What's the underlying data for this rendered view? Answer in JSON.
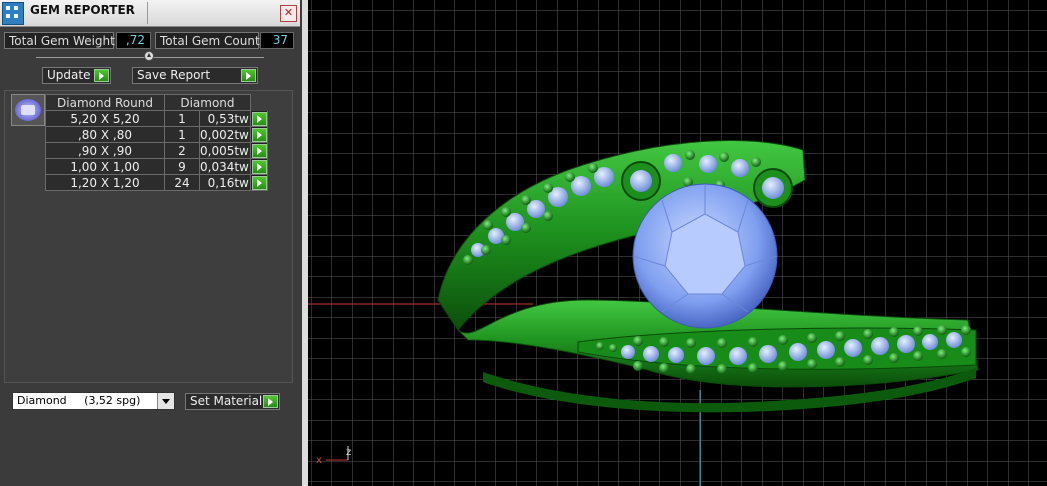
{
  "window": {
    "title": "GEM REPORTER",
    "close_label": "✕"
  },
  "summary": {
    "total_weight_label": "Total Gem Weight",
    "total_weight_value": ",72",
    "total_count_label": "Total Gem Count",
    "total_count_value": "37"
  },
  "buttons": {
    "update": "Update",
    "save_report": "Save Report",
    "set_material": "Set Material"
  },
  "table": {
    "headers": [
      "Diamond Round",
      "Diamond"
    ],
    "rows": [
      {
        "size": "5,20 X 5,20",
        "count": "1",
        "weight": "0,53tw"
      },
      {
        "size": ",80 X ,80",
        "count": "1",
        "weight": "0,002tw"
      },
      {
        "size": ",90 X ,90",
        "count": "2",
        "weight": "0,005tw"
      },
      {
        "size": "1,00 X 1,00",
        "count": "9",
        "weight": "0,034tw"
      },
      {
        "size": "1,20 X 1,20",
        "count": "24",
        "weight": "0,16tw"
      }
    ]
  },
  "material": {
    "selected": "Diamond     (3,52 spg)"
  },
  "viewport": {
    "axis_x": "x",
    "axis_z": "z",
    "colors": {
      "grid": "#5a5a5a",
      "ring": "#1f9a1f",
      "gem": "#8fb0ff",
      "axis_x": "#c0392b"
    }
  }
}
